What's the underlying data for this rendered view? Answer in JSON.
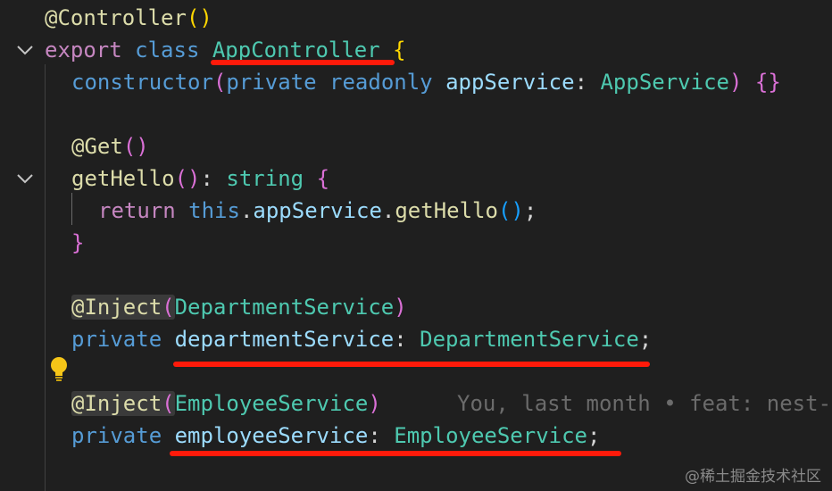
{
  "code": {
    "l1": {
      "at": "@",
      "decorator": "Controller",
      "paren": "()"
    },
    "l2": {
      "export": "export",
      "class": "class",
      "name": "AppController",
      "brace": "{"
    },
    "l3": {
      "constructor": "constructor",
      "open": "(",
      "private": "private",
      "readonly": "readonly",
      "param": "appService",
      "colon": ":",
      "type": "AppService",
      "close": ")",
      "body": "{}"
    },
    "l5": {
      "at": "@",
      "decorator": "Get",
      "paren": "()"
    },
    "l6": {
      "method": "getHello",
      "paren": "()",
      "colon": ":",
      "type": "string",
      "brace": "{"
    },
    "l7": {
      "return": "return",
      "this": "this",
      "dot1": ".",
      "prop": "appService",
      "dot2": ".",
      "call": "getHello",
      "paren": "()",
      "semi": ";"
    },
    "l8": {
      "brace": "}"
    },
    "l10": {
      "at": "@",
      "decorator": "Inject",
      "open": "(",
      "arg": "DepartmentService",
      "close": ")"
    },
    "l11": {
      "private": "private",
      "prop": "departmentService",
      "colon": ":",
      "type": "DepartmentService",
      "semi": ";"
    },
    "l13": {
      "at": "@",
      "decorator": "Inject",
      "open": "(",
      "arg": "EmployeeService",
      "close": ")"
    },
    "l14": {
      "private": "private",
      "prop": "employeeService",
      "colon": ":",
      "type": "EmployeeService",
      "semi": ";"
    }
  },
  "blame": "You, last month • feat: nest-",
  "watermark": "@稀土掘金技术社区",
  "icons": {
    "fold": "chevron-down-icon",
    "lightbulb": "lightbulb-icon"
  },
  "colors": {
    "background": "#1f1f1f",
    "keyword_blue": "#569cd6",
    "keyword_purple": "#c586c0",
    "function": "#dcdcaa",
    "type": "#4ec9b0",
    "variable": "#9cdcfe",
    "annotation_underline": "#ff1a0a",
    "bulb": "#f5c518"
  }
}
